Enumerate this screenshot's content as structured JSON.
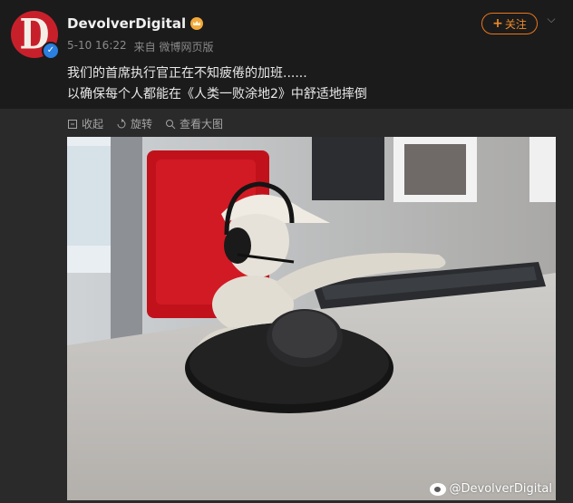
{
  "post": {
    "author": "DevolverDigital",
    "avatar_letter": "D",
    "meta": {
      "date": "5-10 16:22",
      "source": "来自 微博网页版"
    },
    "follow_label": "关注",
    "follow_plus": "+",
    "text_lines": [
      "我们的首席执行官正在不知疲倦的加班......",
      "以确保每个人都能在《人类一败涂地2》中舒适地摔倒"
    ],
    "actions": {
      "collapse": "收起",
      "rotate": "旋转",
      "view_large": "查看大图"
    },
    "watermark": "@DevolverDigital"
  },
  "colors": {
    "follow_accent": "#e8761c",
    "avatar_bg": "#c8202b",
    "verified": "#2b7fe0"
  },
  "icons": [
    "verified-badge-icon",
    "crown-icon",
    "chevron-down-icon",
    "collapse-icon",
    "rotate-icon",
    "zoom-icon",
    "weibo-logo-icon"
  ]
}
